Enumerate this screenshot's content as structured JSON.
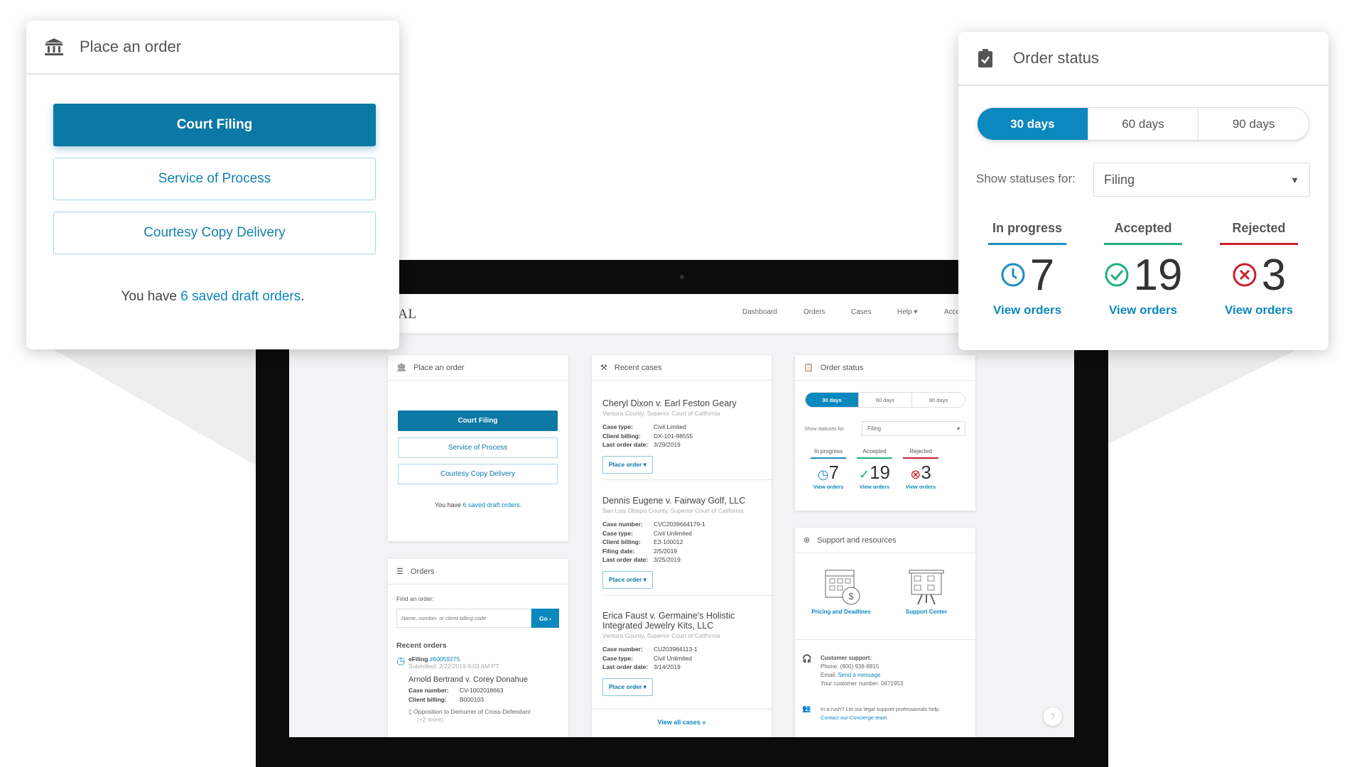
{
  "colors": {
    "brand": "#0b78a6",
    "link": "#0b88bd",
    "in_progress": "#1c8cc4",
    "accepted": "#1fae7f",
    "rejected": "#c8202c",
    "logo_red": "#b0202a"
  },
  "app": {
    "logo": "One Legal",
    "nav": [
      "Dashboard",
      "Orders",
      "Cases",
      "Help",
      "Acco"
    ],
    "place_order": {
      "title": "Place an order",
      "icon": "courthouse-icon",
      "buttons": [
        "Court Filing",
        "Service of Process",
        "Courtesy Copy Delivery"
      ],
      "draft_prefix": "You have ",
      "draft_link": "6 saved draft orders",
      "draft_suffix": "."
    },
    "orders": {
      "title": "Orders",
      "icon": "list-icon",
      "find_label": "Find an order:",
      "search_placeholder": "Name, number, or client billing code",
      "go_label": "Go ›",
      "recent_label": "Recent orders",
      "recent": {
        "type": "eFiling",
        "number": "#60059275",
        "submitted": "Submitted: 2/22/2019 9:03 AM PT",
        "case": "Arnold Bertrand v. Corey Donahue",
        "case_number_label": "Case number:",
        "case_number": "CV-1002018663",
        "billing_label": "Client billing:",
        "billing": "B000103",
        "document": "Opposition to Demurrer of Cross-Defendant",
        "more": "(+2 more)"
      }
    },
    "recent_cases": {
      "title": "Recent cases",
      "icon": "gavel-icon",
      "place_order_label": "Place order ▾",
      "view_all": "View all cases »",
      "cases": [
        {
          "title": "Cheryl Dixon v. Earl Feston Geary",
          "court": "Ventura County, Superior Court of California",
          "fields": [
            [
              "Case type:",
              "Civil Limited"
            ],
            [
              "Client billing:",
              "DX-101-98555"
            ],
            [
              "Last order date:",
              "3/29/2019"
            ]
          ]
        },
        {
          "title": "Dennis Eugene v. Fairway Golf, LLC",
          "court": "San Luis Obispo County, Superior Court of California",
          "fields": [
            [
              "Case number:",
              "CVC2039664179-1"
            ],
            [
              "Case type:",
              "Civil Unlimited"
            ],
            [
              "Client billing:",
              "E3-100012"
            ],
            [
              "Filing date:",
              "2/5/2019"
            ],
            [
              "Last order date:",
              "3/25/2019"
            ]
          ]
        },
        {
          "title": "Erica Faust v. Germaine's Holistic Integrated Jewelry Kits, LLC",
          "court": "Ventura County, Superior Court of California",
          "fields": [
            [
              "Case number:",
              "CU203984113-1"
            ],
            [
              "Case type:",
              "Civil Unlimited"
            ],
            [
              "Last order date:",
              "3/14/2019"
            ]
          ]
        }
      ]
    },
    "order_status": {
      "title": "Order status",
      "icon": "clipboard-check-icon",
      "tabs": [
        "30 days",
        "60 days",
        "90 days"
      ],
      "active_tab": "30 days",
      "show_label": "Show statuses for:",
      "select_value": "Filing",
      "columns": [
        {
          "label": "In progress",
          "count": "7",
          "icon": "clock-icon",
          "link": "View orders"
        },
        {
          "label": "Accepted",
          "count": "19",
          "icon": "check-circle-icon",
          "link": "View orders"
        },
        {
          "label": "Rejected",
          "count": "3",
          "icon": "x-circle-icon",
          "link": "View orders"
        }
      ]
    },
    "support": {
      "title": "Support and resources",
      "icon": "lifebuoy-icon",
      "resources": [
        "Pricing and Deadlines",
        "Support Center"
      ],
      "customer_support": "Customer support:",
      "phone": "Phone: (800) 938-8815",
      "email_label": "Email: ",
      "email_link": "Send a message",
      "customer_number": "Your customer number: 0671953",
      "rush": "In a rush? Let our legal support professionals help.",
      "concierge": "Contact our Concierge team"
    },
    "help": "?"
  }
}
